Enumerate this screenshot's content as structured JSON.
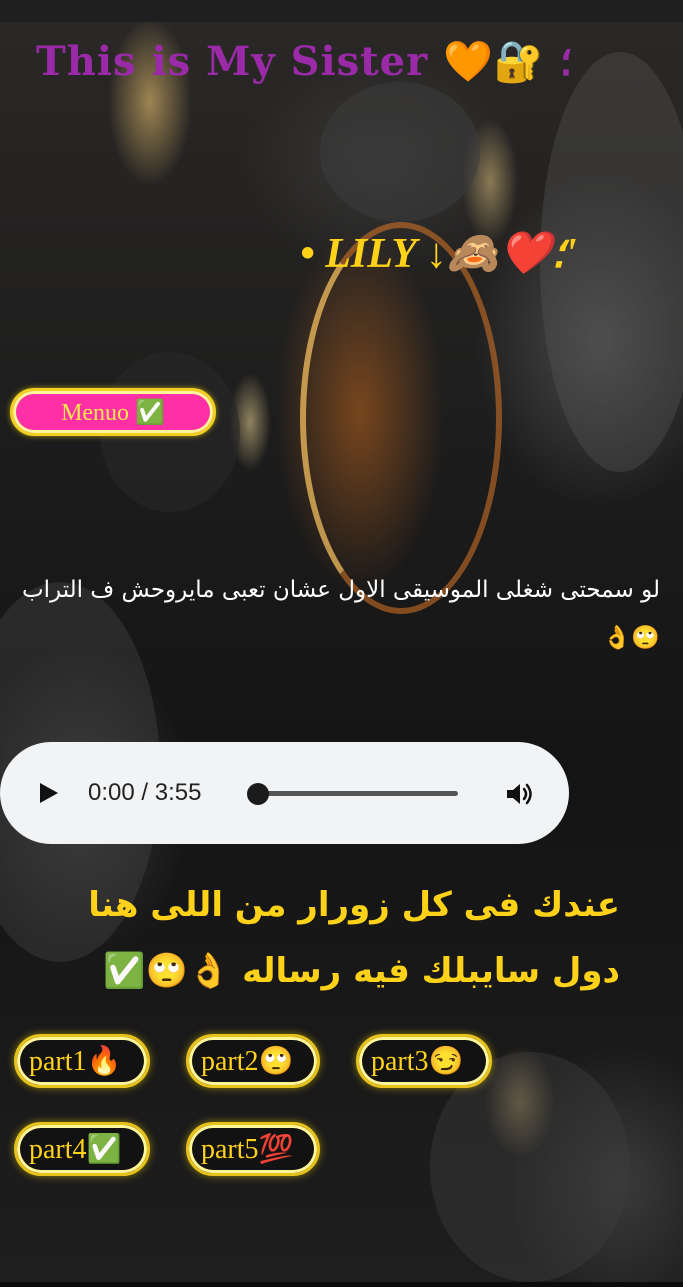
{
  "page": {
    "title": "This is My Sister 🧡🔐 ؛",
    "subtitle": "• LILY ↓🙈❤️؛'",
    "menu_label": "Menuo ✅",
    "note": "لو سمحتى شغلى الموسيقى الاول عشان تعبى مايروحش ف التراب 🙄👌",
    "headline": "عندك فى كل زورار من اللى هنا دول سايبلك فيه رساله 👌🙄✅"
  },
  "audio": {
    "time_display": "0:00 / 3:55",
    "progress": 0,
    "icons": {
      "play": "play-icon",
      "volume": "volume-icon"
    }
  },
  "parts": [
    {
      "label": "part1🔥"
    },
    {
      "label": "part2🙄"
    },
    {
      "label": "part3😏"
    },
    {
      "label": "part4✅"
    },
    {
      "label": "part5💯"
    }
  ],
  "colors": {
    "title": "#9b2aa8",
    "accent_yellow": "#ffd21a",
    "menu_pink": "#ff2fa6",
    "player_bg": "#f2f3f5"
  }
}
